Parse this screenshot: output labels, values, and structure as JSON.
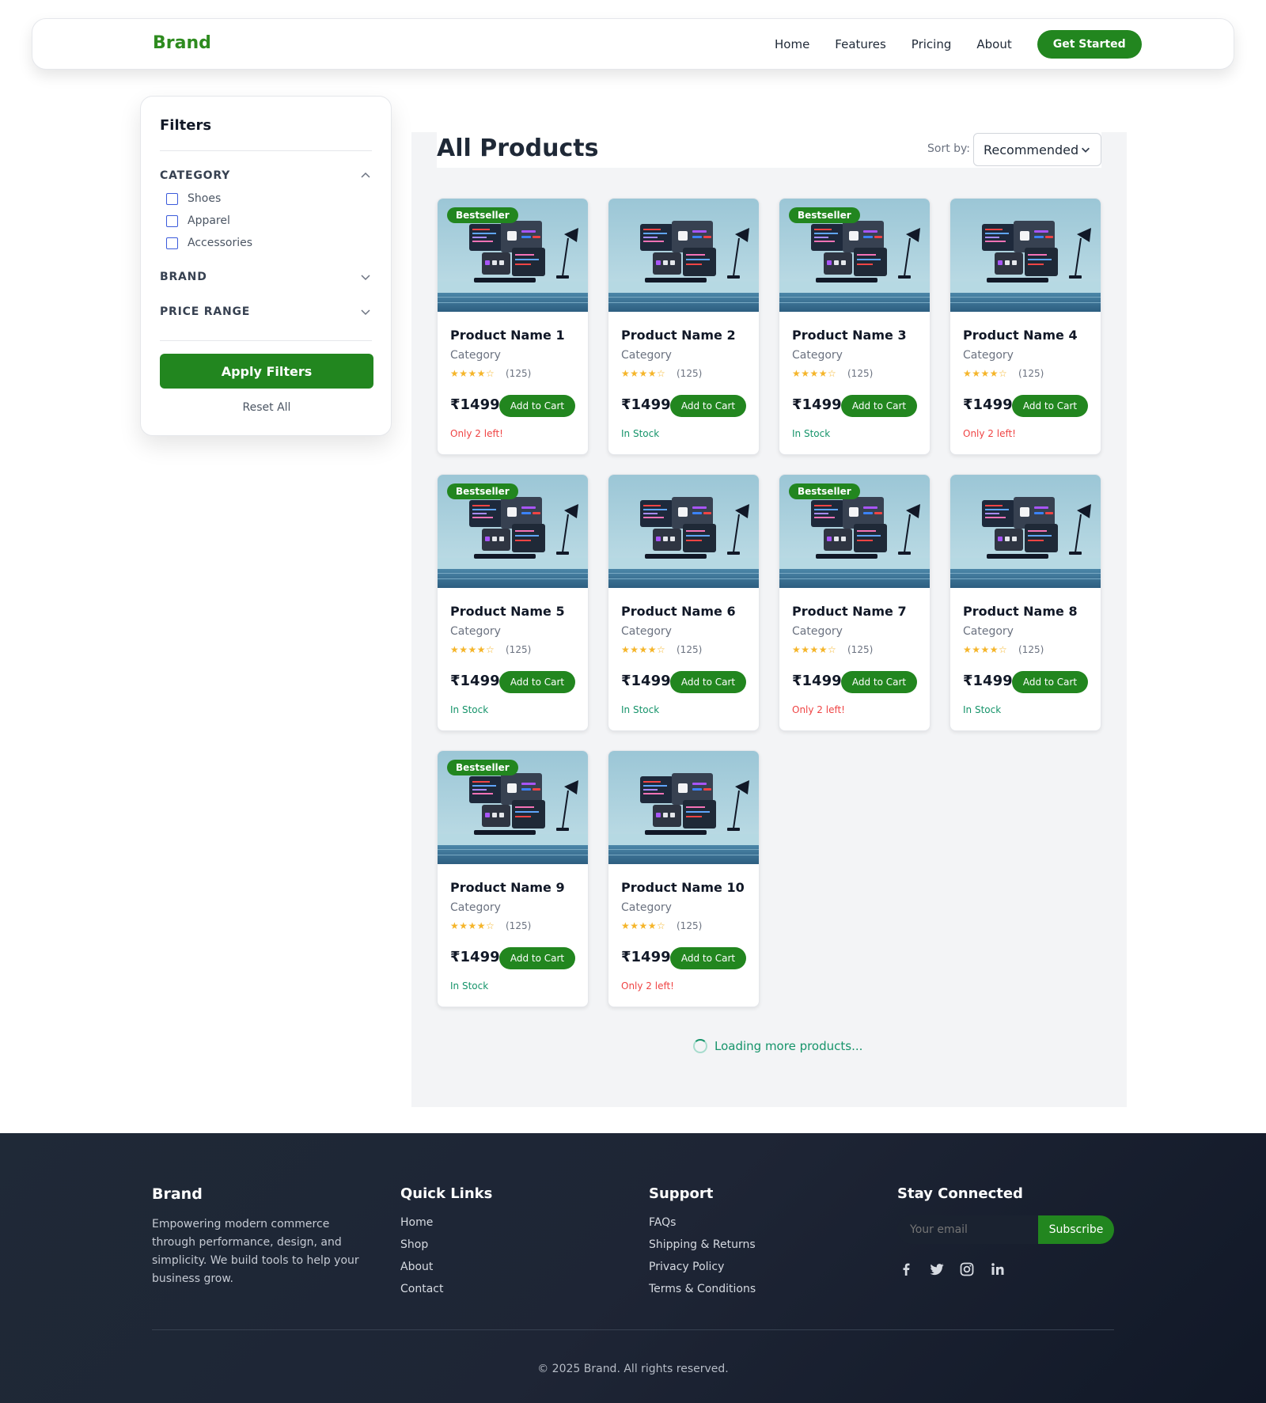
{
  "header": {
    "brand": "Brand",
    "nav": [
      "Home",
      "Features",
      "Pricing",
      "About"
    ],
    "cta": "Get Started"
  },
  "filters": {
    "title": "Filters",
    "category_label": "CATEGORY",
    "category_options": [
      "Shoes",
      "Apparel",
      "Accessories"
    ],
    "brand_label": "BRAND",
    "price_label": "PRICE RANGE",
    "apply": "Apply Filters",
    "reset": "Reset All"
  },
  "main": {
    "title": "All Products",
    "sort_label": "Sort by:",
    "sort_value": "Recommended"
  },
  "colors": {
    "accent": "#22861f",
    "in_stock": "#16946a",
    "low_stock": "#ef4444",
    "star": "#f5b52a"
  },
  "products": [
    {
      "name": "Product Name 1",
      "category": "Category",
      "rating": 4,
      "reviews": "(125)",
      "price": "₹1499",
      "stock": "Only 2 left!",
      "stock_status": "low",
      "badge": "Bestseller"
    },
    {
      "name": "Product Name 2",
      "category": "Category",
      "rating": 4,
      "reviews": "(125)",
      "price": "₹1499",
      "stock": "In Stock",
      "stock_status": "in",
      "badge": ""
    },
    {
      "name": "Product Name 3",
      "category": "Category",
      "rating": 4,
      "reviews": "(125)",
      "price": "₹1499",
      "stock": "In Stock",
      "stock_status": "in",
      "badge": "Bestseller"
    },
    {
      "name": "Product Name 4",
      "category": "Category",
      "rating": 4,
      "reviews": "(125)",
      "price": "₹1499",
      "stock": "Only 2 left!",
      "stock_status": "low",
      "badge": ""
    },
    {
      "name": "Product Name 5",
      "category": "Category",
      "rating": 4,
      "reviews": "(125)",
      "price": "₹1499",
      "stock": "In Stock",
      "stock_status": "in",
      "badge": "Bestseller"
    },
    {
      "name": "Product Name 6",
      "category": "Category",
      "rating": 4,
      "reviews": "(125)",
      "price": "₹1499",
      "stock": "In Stock",
      "stock_status": "in",
      "badge": ""
    },
    {
      "name": "Product Name 7",
      "category": "Category",
      "rating": 4,
      "reviews": "(125)",
      "price": "₹1499",
      "stock": "Only 2 left!",
      "stock_status": "low",
      "badge": "Bestseller"
    },
    {
      "name": "Product Name 8",
      "category": "Category",
      "rating": 4,
      "reviews": "(125)",
      "price": "₹1499",
      "stock": "In Stock",
      "stock_status": "in",
      "badge": ""
    },
    {
      "name": "Product Name 9",
      "category": "Category",
      "rating": 4,
      "reviews": "(125)",
      "price": "₹1499",
      "stock": "In Stock",
      "stock_status": "in",
      "badge": "Bestseller"
    },
    {
      "name": "Product Name 10",
      "category": "Category",
      "rating": 4,
      "reviews": "(125)",
      "price": "₹1499",
      "stock": "Only 2 left!",
      "stock_status": "low",
      "badge": ""
    }
  ],
  "add_to_cart": "Add to Cart",
  "loading": "Loading more products...",
  "footer": {
    "brand": "Brand",
    "description": "Empowering modern commerce through performance, design, and simplicity. We build tools to help your business grow.",
    "quick_links_title": "Quick Links",
    "quick_links": [
      "Home",
      "Shop",
      "About",
      "Contact"
    ],
    "support_title": "Support",
    "support_links": [
      "FAQs",
      "Shipping & Returns",
      "Privacy Policy",
      "Terms & Conditions"
    ],
    "connected_title": "Stay Connected",
    "email_placeholder": "Your email",
    "subscribe": "Subscribe",
    "social_icons": [
      "facebook-icon",
      "twitter-icon",
      "instagram-icon",
      "linkedin-icon"
    ],
    "copyright": "© 2025 Brand. All rights reserved."
  }
}
